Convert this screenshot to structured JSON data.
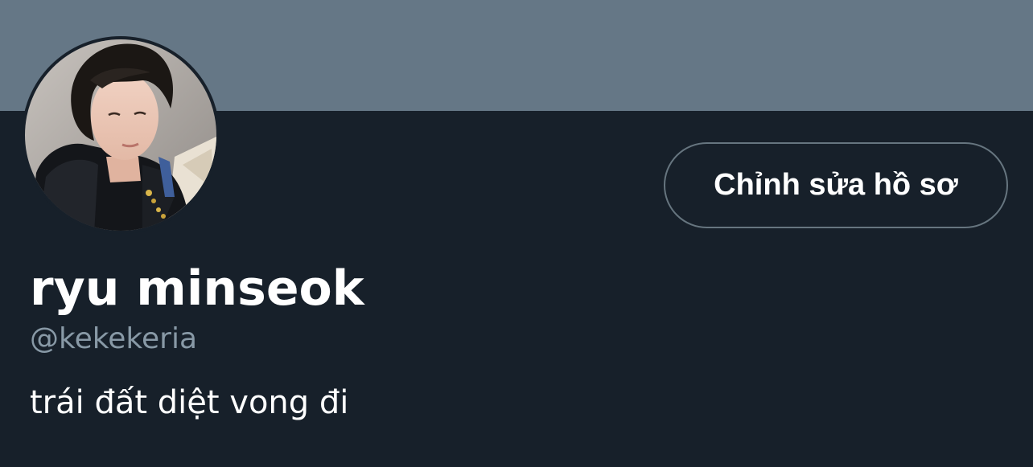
{
  "profile": {
    "display_name": "ryu minseok",
    "handle": "@kekekeria",
    "bio": "trái đất diệt vong đi",
    "edit_button_label": "Chỉnh sửa hồ sơ"
  },
  "colors": {
    "banner": "#657786",
    "background": "#17202a",
    "text_primary": "#ffffff",
    "text_secondary": "#8899a6",
    "button_border": "#66757f"
  }
}
